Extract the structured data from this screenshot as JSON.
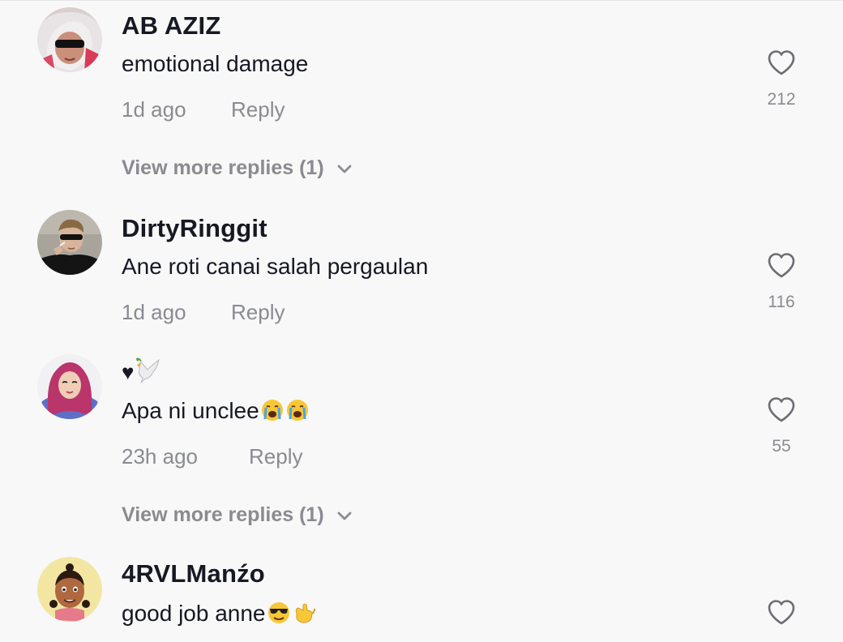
{
  "comments": [
    {
      "username": "AB AZIZ",
      "text": "emotional damage",
      "time": "1d ago",
      "reply_label": "Reply",
      "likes": "212",
      "view_more": "View more replies (1)",
      "avatar_icon": "avatar-hijab-sunglasses"
    },
    {
      "username": "DirtyRinggit",
      "text": "Ane roti canai salah pergaulan",
      "time": "1d ago",
      "reply_label": "Reply",
      "likes": "116",
      "avatar_icon": "avatar-man-sunglasses"
    },
    {
      "username": "♥🕊️",
      "text": "Apa ni unclee",
      "text_emojis": [
        "loudly-crying-face",
        "loudly-crying-face"
      ],
      "time": "23h ago",
      "reply_label": "Reply",
      "likes": "55",
      "view_more": "View more replies (1)",
      "avatar_icon": "avatar-hijab-cartoon"
    },
    {
      "username": "4RVLManźo",
      "text": "good job anne",
      "text_emojis": [
        "smiling-face-with-sunglasses",
        "call-me-hand"
      ],
      "avatar_icon": "avatar-cartoon-character"
    }
  ],
  "colors": {
    "background": "#f8f8f8",
    "primary_text": "#161823",
    "secondary_text": "#8a8b91"
  },
  "icons": {
    "like": "heart-outline-icon",
    "expand": "chevron-down-icon"
  }
}
